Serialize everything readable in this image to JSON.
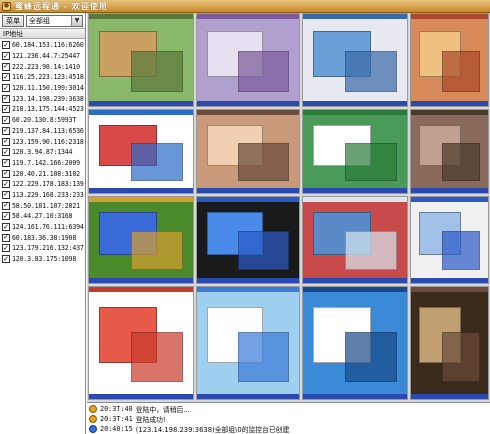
{
  "window": {
    "title": "蜜蜂远程通 - 欢迎使用"
  },
  "toolbar": {
    "menu_label": "菜单",
    "group_value": "全部组"
  },
  "ip_list": {
    "header": "IP地址",
    "items": [
      "60.184.153.116:6260",
      "121.236.44.7:25447",
      "222.223.98.14:1410",
      "116.25.223.123:4518",
      "120.11.150.199:3014",
      "123.14.198.239:3638",
      "218.13.175.144:4523",
      "60.20.130.8:5993T",
      "219.137.84.113:6536",
      "123.159.90.116:2318",
      "120.3.94.87:1344",
      "119.7.142.166:2009",
      "120.40.21.108:3102",
      "122.229.178.183:139",
      "113.229.168.233:233",
      "58.50.181.107:2021",
      "58.44.27.10:3168",
      "124.161.76.111:6394",
      "60.183.36.38:1908",
      "123.179.216.132:437",
      "120.3.83.175:1098"
    ]
  },
  "log": {
    "entries": [
      {
        "time": "20:3T:40",
        "text": "登陆中，请稍后...",
        "icon": "info-icon"
      },
      {
        "time": "20:3T:41",
        "text": "登陆成功!",
        "icon": "info-icon"
      },
      {
        "time": "20:40:15",
        "text": "(123.14.198.239:3638)全部组\\0的监控台已创建",
        "icon": "info-icon"
      }
    ]
  },
  "colors": {
    "titlebar": "#c88a2a",
    "grid_bg": "#d8d8d8",
    "checkbox": "#000000"
  }
}
